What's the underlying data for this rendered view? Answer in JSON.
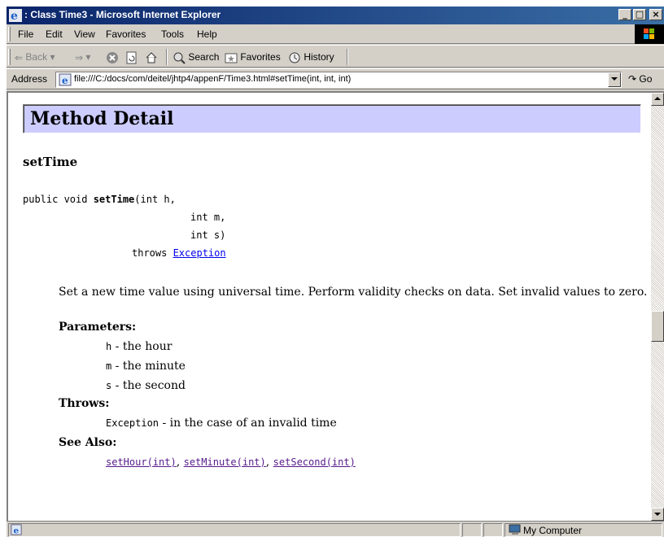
{
  "window": {
    "title": ": Class Time3 - Microsoft Internet Explorer",
    "min_label": "_",
    "max_label": "□",
    "close_label": "×"
  },
  "menu": {
    "items": [
      "File",
      "Edit",
      "View",
      "Favorites",
      "Tools",
      "Help"
    ]
  },
  "toolbar": {
    "back": "Back",
    "search": "Search",
    "favorites": "Favorites",
    "history": "History"
  },
  "address": {
    "label": "Address",
    "url": "file:///C:/docs/com/deitel/jhtp4/appenF/Time3.html#setTime(int, int, int)",
    "go": "Go"
  },
  "doc": {
    "section_heading": "Method Detail",
    "method_name": "setTime",
    "signature": {
      "line1_prefix": "public void ",
      "line1_method": "setTime",
      "line1_param": "(int h,",
      "line2": "int m,",
      "line3": "int s)",
      "throws_kw": "throws ",
      "throws_link": "Exception"
    },
    "description": "Set a new time value using universal time. Perform validity checks on data. Set invalid values to zero.",
    "parameters_label": "Parameters:",
    "params": [
      {
        "code": "h",
        "text": " - the hour"
      },
      {
        "code": "m",
        "text": " - the minute"
      },
      {
        "code": "s",
        "text": " - the second"
      }
    ],
    "throws_label": "Throws:",
    "throws_item": {
      "code": "Exception",
      "text": " - in the case of an invalid time"
    },
    "see_also_label": "See Also:",
    "see_also": [
      "setHour(int)",
      "setMinute(int)",
      "setSecond(int)"
    ],
    "see_also_sep": ", "
  },
  "status": {
    "zone": "My Computer"
  },
  "colors": {
    "title_bar": "#0a246a",
    "chrome": "#d4d0c8",
    "heading_band": "#ccccff",
    "link": "#0000ee",
    "visited_link": "#551a8b"
  }
}
